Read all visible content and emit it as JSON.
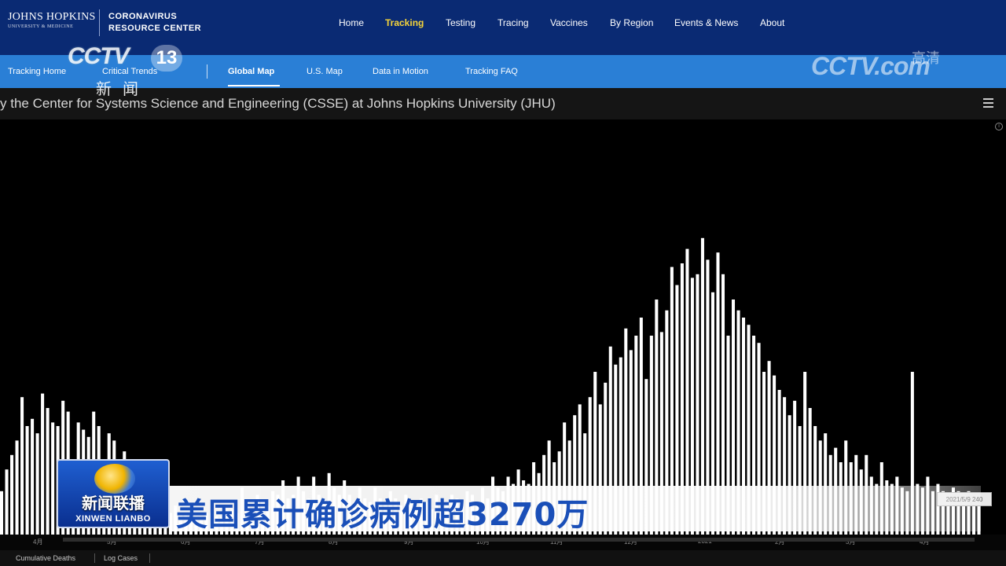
{
  "header": {
    "logo_line1": "JOHNS HOPKINS",
    "logo_line2": "UNIVERSITY & MEDICINE",
    "center_line1": "CORONAVIRUS",
    "center_line2": "RESOURCE CENTER",
    "nav": [
      {
        "label": "Home",
        "active": false
      },
      {
        "label": "Tracking",
        "active": true
      },
      {
        "label": "Testing",
        "active": false
      },
      {
        "label": "Tracing",
        "active": false
      },
      {
        "label": "Vaccines",
        "active": false
      },
      {
        "label": "By Region",
        "active": false
      },
      {
        "label": "Events & News",
        "active": false
      },
      {
        "label": "About",
        "active": false
      }
    ]
  },
  "subnav": {
    "items": [
      {
        "label": "Tracking Home",
        "active": false
      },
      {
        "label": "Critical Trends",
        "active": false
      },
      {
        "label": "Global Map",
        "active": true
      },
      {
        "label": "U.S. Map",
        "active": false
      },
      {
        "label": "Data in Motion",
        "active": false
      },
      {
        "label": "Tracking FAQ",
        "active": false
      }
    ]
  },
  "source_text": "y the Center for Systems Science and Engineering (CSSE) at Johns Hopkins University (JHU)",
  "menu_icon": "hamburger-menu-icon",
  "chart_data": {
    "type": "bar",
    "title": "",
    "xlabel": "",
    "ylabel": "",
    "x_ticks": [
      "4月",
      "5月",
      "6月",
      "7月",
      "8月",
      "9月",
      "10月",
      "11月",
      "12月",
      "2021",
      "2月",
      "3月",
      "4月"
    ],
    "date_label": "2021/5/9 240",
    "bar_color": "#ffffff",
    "background": "#000000",
    "values": [
      0.12,
      0.18,
      0.22,
      0.26,
      0.38,
      0.3,
      0.32,
      0.28,
      0.39,
      0.35,
      0.31,
      0.3,
      0.37,
      0.34,
      0.2,
      0.31,
      0.29,
      0.27,
      0.34,
      0.3,
      0.16,
      0.28,
      0.26,
      0.18,
      0.23,
      0.17,
      0.15,
      0.14,
      0.18,
      0.11,
      0.09,
      0.12,
      0.07,
      0.06,
      0.08,
      0.06,
      0.06,
      0.07,
      0.05,
      0.05,
      0.06,
      0.06,
      0.05,
      0.05,
      0.07,
      0.07,
      0.06,
      0.13,
      0.08,
      0.07,
      0.11,
      0.09,
      0.08,
      0.12,
      0.11,
      0.15,
      0.1,
      0.11,
      0.16,
      0.12,
      0.1,
      0.16,
      0.11,
      0.1,
      0.17,
      0.13,
      0.11,
      0.15,
      0.11,
      0.09,
      0.13,
      0.1,
      0.09,
      0.13,
      0.1,
      0.09,
      0.12,
      0.1,
      0.08,
      0.11,
      0.09,
      0.07,
      0.1,
      0.09,
      0.07,
      0.11,
      0.09,
      0.08,
      0.11,
      0.1,
      0.09,
      0.12,
      0.11,
      0.09,
      0.13,
      0.1,
      0.16,
      0.13,
      0.12,
      0.16,
      0.14,
      0.18,
      0.15,
      0.14,
      0.2,
      0.17,
      0.22,
      0.26,
      0.2,
      0.23,
      0.31,
      0.26,
      0.33,
      0.36,
      0.28,
      0.38,
      0.45,
      0.36,
      0.42,
      0.52,
      0.47,
      0.49,
      0.57,
      0.51,
      0.55,
      0.6,
      0.43,
      0.55,
      0.65,
      0.56,
      0.62,
      0.74,
      0.69,
      0.75,
      0.79,
      0.71,
      0.72,
      0.82,
      0.76,
      0.67,
      0.78,
      0.72,
      0.55,
      0.65,
      0.62,
      0.6,
      0.58,
      0.55,
      0.53,
      0.45,
      0.48,
      0.44,
      0.4,
      0.38,
      0.33,
      0.37,
      0.3,
      0.45,
      0.35,
      0.3,
      0.26,
      0.28,
      0.22,
      0.24,
      0.2,
      0.26,
      0.2,
      0.22,
      0.18,
      0.22,
      0.16,
      0.14,
      0.2,
      0.15,
      0.14,
      0.16,
      0.13,
      0.12,
      0.45,
      0.14,
      0.13,
      0.16,
      0.12,
      0.14,
      0.12,
      0.11,
      0.13,
      0.12,
      0.1,
      0.12,
      0.11,
      0.1
    ]
  },
  "bottom_tabs": [
    "Cumulative Deaths",
    "Log Cases"
  ],
  "watermark": {
    "cctv_mark": "CCTV",
    "channel_number": "13",
    "channel_cn": "新闻",
    "hd_mark": "CCTV.com",
    "hd_cn": "高清"
  },
  "caption": {
    "program_title": "新闻联播",
    "program_sub": "XINWEN LIANBO",
    "headline": "美国累计确诊病例超3270万"
  }
}
